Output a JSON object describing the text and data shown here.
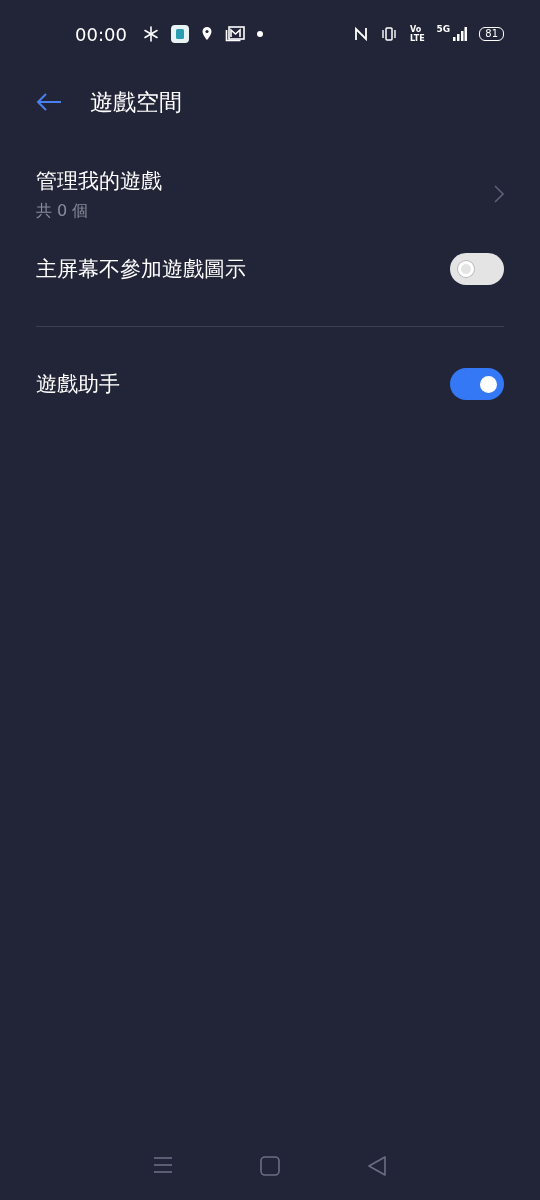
{
  "status_bar": {
    "time": "00:00",
    "volte_top": "Vo",
    "volte_bottom": "LTE",
    "network": "5G",
    "battery": "81"
  },
  "header": {
    "title": "遊戲空間"
  },
  "items": [
    {
      "kind": "link",
      "label": "管理我的遊戲",
      "subtitle": "共 0 個"
    },
    {
      "kind": "toggle",
      "label": "主屏幕不參加遊戲圖示",
      "on": false
    },
    {
      "kind": "divider"
    },
    {
      "kind": "toggle",
      "label": "遊戲助手",
      "on": true
    }
  ]
}
